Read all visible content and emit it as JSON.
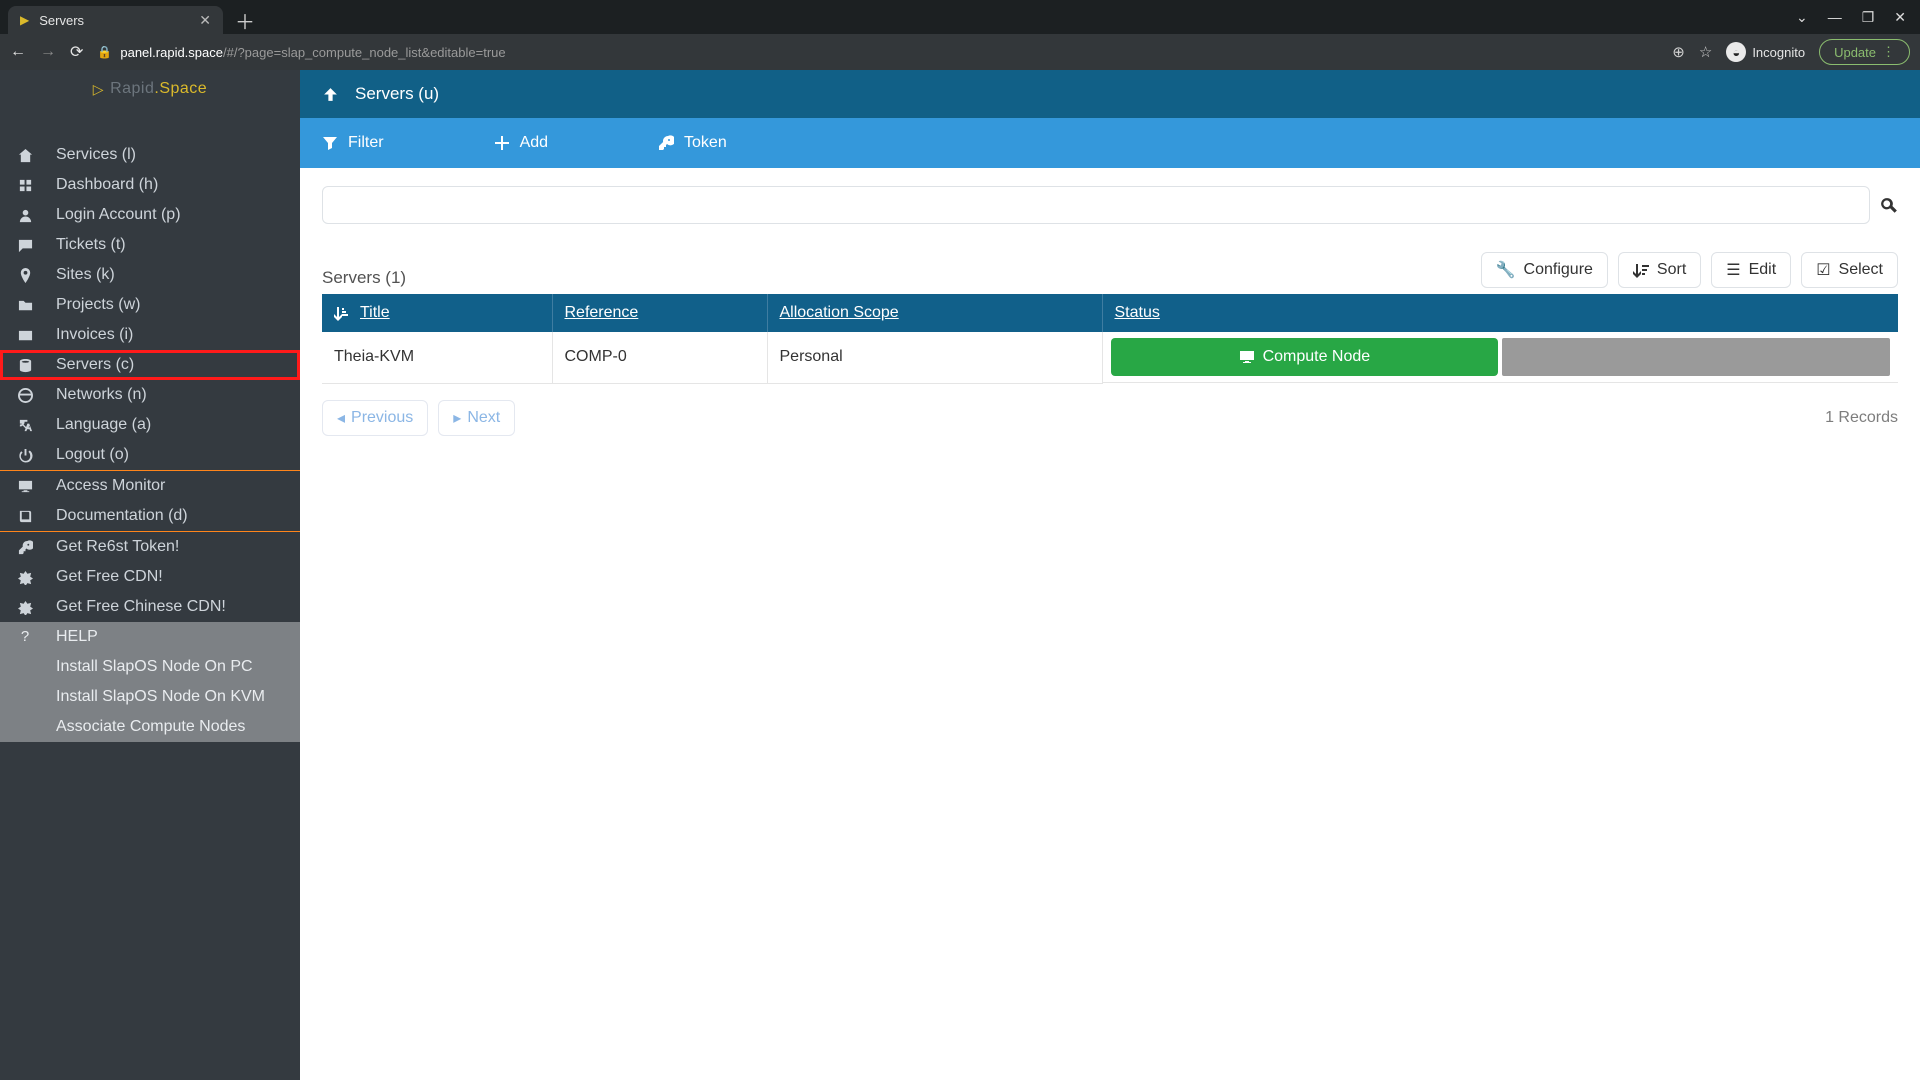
{
  "browser": {
    "tab_title": "Servers",
    "url_host": "panel.rapid.space",
    "url_path": "/#/?page=slap_compute_node_list&editable=true",
    "incognito": "Incognito",
    "update": "Update"
  },
  "logo": {
    "brand1": "Rapid",
    "brand2": ".Space"
  },
  "sidebar": {
    "main": [
      {
        "icon": "home",
        "label": "Services (l)"
      },
      {
        "icon": "dash",
        "label": "Dashboard (h)"
      },
      {
        "icon": "user",
        "label": "Login Account (p)"
      },
      {
        "icon": "chat",
        "label": "Tickets (t)"
      },
      {
        "icon": "pin",
        "label": "Sites (k)"
      },
      {
        "icon": "folder",
        "label": "Projects (w)"
      },
      {
        "icon": "card",
        "label": "Invoices (i)"
      },
      {
        "icon": "db",
        "label": "Servers (c)",
        "hl": true
      },
      {
        "icon": "globe",
        "label": "Networks (n)"
      },
      {
        "icon": "lang",
        "label": "Language (a)"
      },
      {
        "icon": "power",
        "label": "Logout (o)"
      }
    ],
    "section2": [
      {
        "icon": "monitor",
        "label": "Access Monitor"
      },
      {
        "icon": "book",
        "label": "Documentation (d)"
      }
    ],
    "section3": [
      {
        "icon": "key",
        "label": "Get Re6st Token!"
      },
      {
        "icon": "puzzle",
        "label": "Get Free CDN!"
      },
      {
        "icon": "puzzle",
        "label": "Get Free Chinese CDN!"
      }
    ],
    "help": {
      "title": "HELP",
      "items": [
        "Install SlapOS Node On PC",
        "Install SlapOS Node On KVM",
        "Associate Compute Nodes"
      ]
    }
  },
  "header": {
    "title": "Servers (u)"
  },
  "toolbar": {
    "filter": "Filter",
    "add": "Add",
    "token": "Token"
  },
  "search": {
    "placeholder": ""
  },
  "list": {
    "caption": "Servers (1)",
    "buttons": {
      "configure": "Configure",
      "sort": "Sort",
      "edit": "Edit",
      "select": "Select"
    },
    "columns": {
      "title": "Title",
      "reference": "Reference",
      "allocation": "Allocation Scope",
      "status": "Status"
    },
    "rows": [
      {
        "title": "Theia-KVM",
        "reference": "COMP-0",
        "allocation": "Personal",
        "status": "Compute Node"
      }
    ],
    "pager": {
      "prev": "Previous",
      "next": "Next",
      "records": "1 Records"
    }
  }
}
